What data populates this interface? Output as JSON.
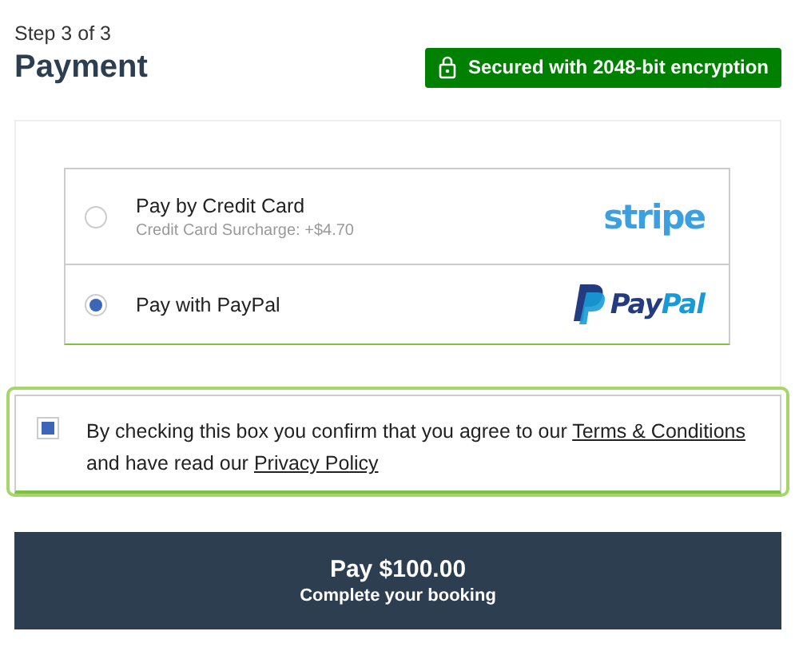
{
  "header": {
    "step": "Step 3 of 3",
    "title": "Payment",
    "badge": "Secured with 2048-bit encryption"
  },
  "methods": [
    {
      "kind": "stripe",
      "label": "Pay by Credit Card",
      "note": "Credit Card Surcharge: +$4.70",
      "logo": "stripe",
      "selected": false
    },
    {
      "kind": "paypal",
      "label": "Pay with PayPal",
      "logo_parts": [
        "Pay",
        "Pal"
      ],
      "selected": true
    }
  ],
  "consent": {
    "checked": true,
    "parts": [
      {
        "kind": "text",
        "text": "By checking this box you confirm that you agree to our "
      },
      {
        "kind": "link",
        "text": "Terms & Conditions"
      },
      {
        "kind": "text",
        "text": " and have read our "
      },
      {
        "kind": "link",
        "text": "Privacy Policy"
      }
    ]
  },
  "pay_button": {
    "title": "Pay $100.00",
    "subtitle": "Complete your booking"
  }
}
